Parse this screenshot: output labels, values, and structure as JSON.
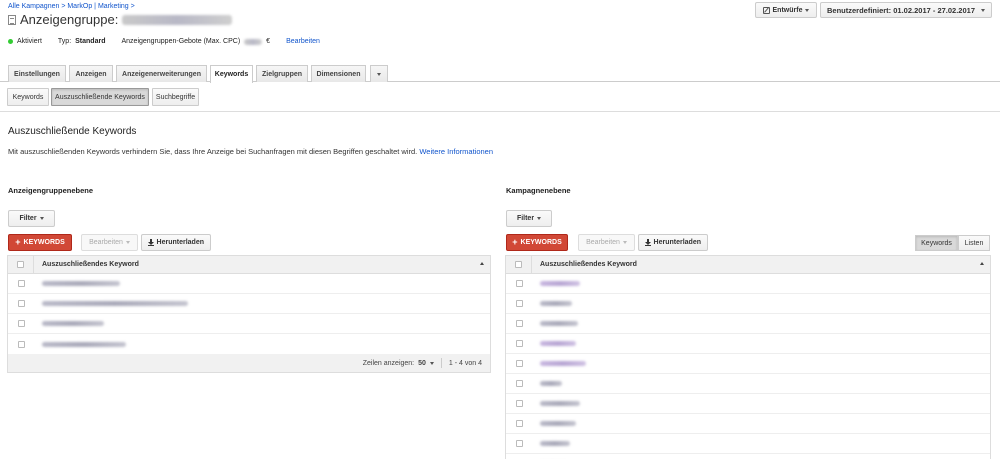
{
  "header": {
    "breadcrumb": "Alle Kampagnen > MarkOp | Marketing >",
    "title_prefix": "Anzeigengruppe:",
    "status": "Aktiviert",
    "type_label": "Typ:",
    "type_value": "Standard",
    "bid_label": "Anzeigengruppen-Gebote (Max. CPC)",
    "bid_currency": "€",
    "edit_link": "Bearbeiten",
    "drafts_button": "Entwürfe",
    "date_range": "Benutzerdefiniert: 01.02.2017 - 27.02.2017"
  },
  "tabs": [
    {
      "label": "Einstellungen"
    },
    {
      "label": "Anzeigen"
    },
    {
      "label": "Anzeigenerweiterungen"
    },
    {
      "label": "Keywords"
    },
    {
      "label": "Zielgruppen"
    },
    {
      "label": "Dimensionen"
    }
  ],
  "subtabs": [
    {
      "label": "Keywords"
    },
    {
      "label": "Auszuschließende Keywords"
    },
    {
      "label": "Suchbegriffe"
    }
  ],
  "section": {
    "title": "Auszuschließende Keywords",
    "description": "Mit auszuschließenden Keywords verhindern Sie, dass Ihre Anzeige bei Suchanfragen mit diesen Begriffen geschaltet wird.",
    "more_info_link": "Weitere Informationen"
  },
  "left_panel": {
    "title": "Anzeigengruppenebene",
    "filter_label": "Filter",
    "add_button": "KEYWORDS",
    "edit_button": "Bearbeiten",
    "download_button": "Herunterladen",
    "column_header": "Auszuschließendes Keyword",
    "rows_per_page_label": "Zeilen anzeigen:",
    "rows_per_page_value": "50",
    "pagination": "1 - 4 von 4"
  },
  "right_panel": {
    "title": "Kampagnenebene",
    "filter_label": "Filter",
    "add_button": "KEYWORDS",
    "edit_button": "Bearbeiten",
    "download_button": "Herunterladen",
    "toggle_keywords": "Keywords",
    "toggle_lists": "Listen",
    "column_header": "Auszuschließendes Keyword"
  },
  "colors": {
    "accent_link": "#1155cc",
    "add_button_red": "#d14836",
    "status_green": "#33cc33"
  }
}
